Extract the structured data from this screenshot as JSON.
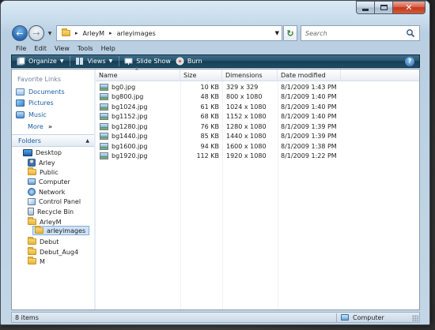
{
  "window": {
    "caption_buttons": [
      "minimize",
      "maximize",
      "close"
    ]
  },
  "address": {
    "icons": {
      "back": "back-arrow-icon",
      "forward": "forward-arrow-icon",
      "refresh": "refresh-icon"
    },
    "crumbs": [
      "ArleyM",
      "arleyimages"
    ]
  },
  "search": {
    "placeholder": "Search"
  },
  "menu": [
    "File",
    "Edit",
    "View",
    "Tools",
    "Help"
  ],
  "toolbar": {
    "organize": "Organize",
    "views": "Views",
    "slideshow": "Slide Show",
    "burn": "Burn"
  },
  "nav": {
    "favorites_title": "Favorite Links",
    "favorites": [
      "Documents",
      "Pictures",
      "Music"
    ],
    "more": "More",
    "folders_title": "Folders",
    "tree": [
      {
        "label": "Desktop",
        "icon": "desktop-icon"
      },
      {
        "label": "Arley",
        "icon": "user-folder-icon"
      },
      {
        "label": "Public",
        "icon": "folder-icon"
      },
      {
        "label": "Computer",
        "icon": "computer-icon"
      },
      {
        "label": "Network",
        "icon": "network-icon"
      },
      {
        "label": "Control Panel",
        "icon": "control-panel-icon"
      },
      {
        "label": "Recycle Bin",
        "icon": "recycle-bin-icon"
      },
      {
        "label": "ArleyM",
        "icon": "folder-icon"
      },
      {
        "label": "arleyimages",
        "icon": "folder-icon",
        "selected": true
      },
      {
        "label": "Debut",
        "icon": "folder-icon"
      },
      {
        "label": "Debut_Aug4",
        "icon": "folder-icon"
      },
      {
        "label": "M",
        "icon": "folder-icon"
      }
    ]
  },
  "columns": {
    "name": "Name",
    "size": "Size",
    "dimensions": "Dimensions",
    "date": "Date modified"
  },
  "files": [
    {
      "name": "bg0.jpg",
      "size": "10 KB",
      "dimensions": "329 x 329",
      "date": "8/1/2009 1:43 PM"
    },
    {
      "name": "bg800.jpg",
      "size": "48 KB",
      "dimensions": "800 x 1080",
      "date": "8/1/2009 1:40 PM"
    },
    {
      "name": "bg1024.jpg",
      "size": "61 KB",
      "dimensions": "1024 x 1080",
      "date": "8/1/2009 1:40 PM"
    },
    {
      "name": "bg1152.jpg",
      "size": "68 KB",
      "dimensions": "1152 x 1080",
      "date": "8/1/2009 1:40 PM"
    },
    {
      "name": "bg1280.jpg",
      "size": "76 KB",
      "dimensions": "1280 x 1080",
      "date": "8/1/2009 1:39 PM"
    },
    {
      "name": "bg1440.jpg",
      "size": "85 KB",
      "dimensions": "1440 x 1080",
      "date": "8/1/2009 1:39 PM"
    },
    {
      "name": "bg1600.jpg",
      "size": "94 KB",
      "dimensions": "1600 x 1080",
      "date": "8/1/2009 1:38 PM"
    },
    {
      "name": "bg1920.jpg",
      "size": "112 KB",
      "dimensions": "1920 x 1080",
      "date": "8/1/2009 1:22 PM"
    }
  ],
  "status": {
    "count": "8 items",
    "location": "Computer"
  },
  "colors": {
    "toolbar": "#1e4c65",
    "link": "#1b5fa3",
    "selection": "#cfe3f8"
  }
}
